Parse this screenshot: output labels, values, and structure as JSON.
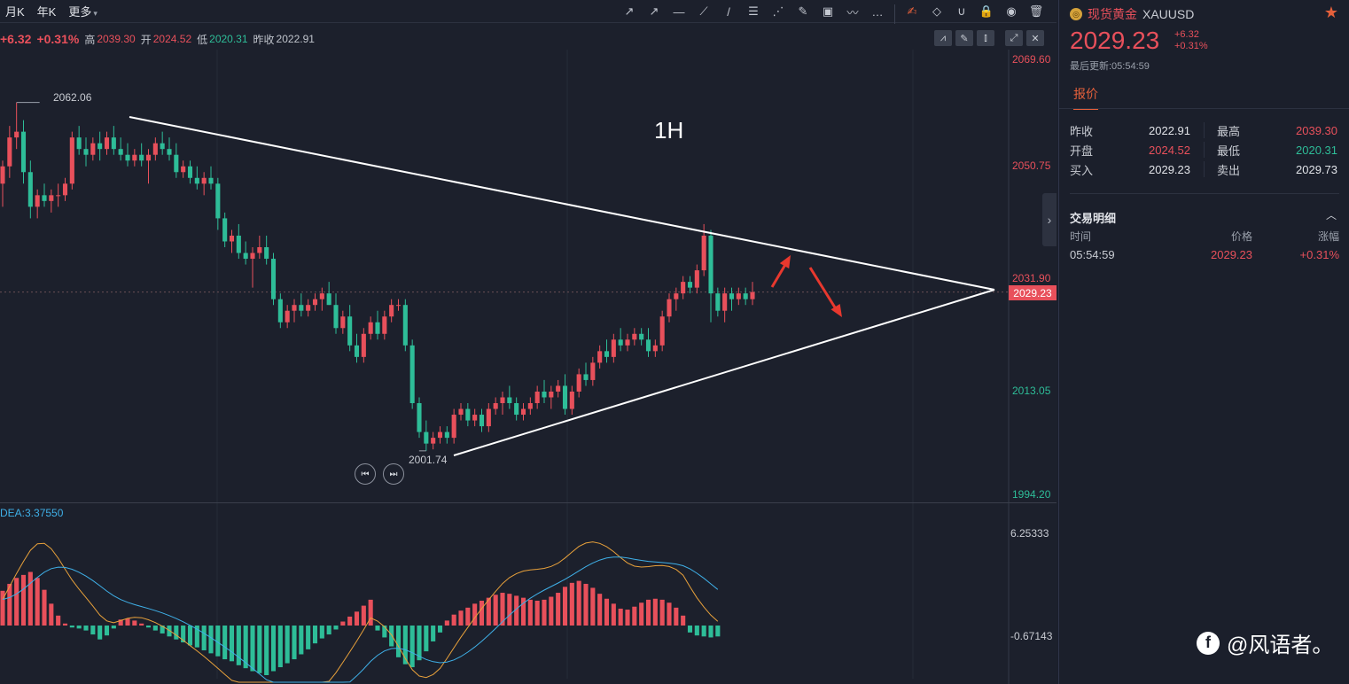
{
  "toolbar": {
    "periods": [
      "月K",
      "年K",
      "更多"
    ],
    "tools": [
      {
        "name": "arrow-line-icon",
        "glyph": "↗"
      },
      {
        "name": "ray-icon",
        "glyph": "↗"
      },
      {
        "name": "horizontal-line-icon",
        "glyph": "—"
      },
      {
        "name": "trend-line-icon",
        "glyph": "⟋"
      },
      {
        "name": "segment-icon",
        "glyph": "/"
      },
      {
        "name": "fibonacci-icon",
        "glyph": "☰"
      },
      {
        "name": "gann-fan-icon",
        "glyph": "⋰"
      },
      {
        "name": "brush-icon",
        "glyph": "✎"
      },
      {
        "name": "image-icon",
        "glyph": "▣"
      },
      {
        "name": "pattern-icon",
        "glyph": "〰"
      },
      {
        "name": "more-tools-icon",
        "glyph": "…"
      },
      {
        "name": "draw-mode-icon",
        "glyph": "✍"
      },
      {
        "name": "eraser-icon",
        "glyph": "◇"
      },
      {
        "name": "magnet-icon",
        "glyph": "∪"
      },
      {
        "name": "lock-icon",
        "glyph": "🔒"
      },
      {
        "name": "eye-icon",
        "glyph": "◉"
      },
      {
        "name": "trash-icon",
        "glyph": "🗑"
      }
    ]
  },
  "infobar": {
    "change": "+6.32",
    "change_pct": "+0.31%",
    "high_label": "高",
    "high": "2039.30",
    "open_label": "开",
    "open": "2024.52",
    "low_label": "低",
    "low": "2020.31",
    "prev_label": "昨收",
    "prev": "2022.91"
  },
  "chart_buttons": [
    {
      "name": "indicator-icon",
      "glyph": "⩘"
    },
    {
      "name": "pen-icon",
      "glyph": "✎"
    },
    {
      "name": "candle-type-icon",
      "glyph": "⫾"
    },
    {
      "name": "expand-icon",
      "glyph": "⤢"
    },
    {
      "name": "close-icon",
      "glyph": "✕"
    }
  ],
  "axis": {
    "price_labels": [
      {
        "value": "2069.60",
        "color": "#e8505b"
      },
      {
        "value": "2050.75",
        "color": "#e8505b"
      },
      {
        "value": "2031.90",
        "color": "#e8505b"
      },
      {
        "value": "2013.05",
        "color": "#2ebd98"
      },
      {
        "value": "1994.20",
        "color": "#2ebd98"
      }
    ],
    "current_price": "2029.23",
    "macd_labels": [
      "6.25333",
      "-0.67143"
    ]
  },
  "annotations": {
    "timeframe": "1H",
    "high_mark": "2062.06",
    "low_mark": "2001.74"
  },
  "macd": {
    "dea_label": "DEA:3.37550"
  },
  "chart_data": {
    "type": "candlestick",
    "symbol": "XAUUSD",
    "timeframe": "1H",
    "ylim": [
      1994.2,
      2069.6
    ],
    "candles": [
      [
        2048,
        2052,
        2044,
        2051
      ],
      [
        2051,
        2058,
        2049,
        2056
      ],
      [
        2056,
        2062.06,
        2054,
        2057
      ],
      [
        2057,
        2059,
        2048,
        2050
      ],
      [
        2050,
        2052,
        2042,
        2044
      ],
      [
        2044,
        2047,
        2042,
        2046
      ],
      [
        2046,
        2048,
        2044,
        2045
      ],
      [
        2045,
        2047,
        2043,
        2046
      ],
      [
        2046,
        2048,
        2044,
        2046
      ],
      [
        2046,
        2049,
        2045,
        2048
      ],
      [
        2048,
        2057,
        2047,
        2056
      ],
      [
        2056,
        2058,
        2053,
        2054
      ],
      [
        2054,
        2056,
        2051,
        2053
      ],
      [
        2053,
        2056,
        2052,
        2055
      ],
      [
        2055,
        2057,
        2052,
        2054
      ],
      [
        2054,
        2057,
        2053,
        2056
      ],
      [
        2056,
        2058,
        2053,
        2054
      ],
      [
        2054,
        2056,
        2052,
        2053
      ],
      [
        2053,
        2055,
        2051,
        2052
      ],
      [
        2052,
        2054,
        2051,
        2053
      ],
      [
        2053,
        2055,
        2051,
        2052
      ],
      [
        2052,
        2054,
        2048,
        2053
      ],
      [
        2053,
        2056,
        2052,
        2055
      ],
      [
        2055,
        2057,
        2053,
        2054
      ],
      [
        2054,
        2056,
        2052,
        2053
      ],
      [
        2053,
        2055,
        2049,
        2050
      ],
      [
        2050,
        2052,
        2049,
        2051
      ],
      [
        2051,
        2052,
        2048,
        2049
      ],
      [
        2049,
        2051,
        2047,
        2048
      ],
      [
        2048,
        2050,
        2046,
        2049
      ],
      [
        2049,
        2051,
        2047,
        2048
      ],
      [
        2048,
        2049,
        2040,
        2042
      ],
      [
        2042,
        2043,
        2037,
        2038
      ],
      [
        2038,
        2040,
        2036,
        2039
      ],
      [
        2039,
        2041,
        2035,
        2036
      ],
      [
        2036,
        2038,
        2034,
        2035
      ],
      [
        2035,
        2037,
        2030,
        2036
      ],
      [
        2036,
        2039,
        2035,
        2037
      ],
      [
        2037,
        2039,
        2034,
        2035
      ],
      [
        2035,
        2036,
        2027,
        2028
      ],
      [
        2028,
        2029,
        2023,
        2024
      ],
      [
        2024,
        2027,
        2023,
        2026
      ],
      [
        2026,
        2028,
        2024,
        2027
      ],
      [
        2027,
        2029,
        2025,
        2026
      ],
      [
        2026,
        2028,
        2025,
        2027
      ],
      [
        2027,
        2029,
        2026,
        2028
      ],
      [
        2028,
        2030,
        2026,
        2029
      ],
      [
        2029,
        2031,
        2027,
        2027
      ],
      [
        2027,
        2029,
        2022,
        2023
      ],
      [
        2023,
        2026,
        2022,
        2025
      ],
      [
        2025,
        2027,
        2019,
        2020
      ],
      [
        2020,
        2022,
        2017,
        2018
      ],
      [
        2018,
        2023,
        2017,
        2022
      ],
      [
        2022,
        2025,
        2021,
        2024
      ],
      [
        2024,
        2026,
        2021,
        2022
      ],
      [
        2022,
        2026,
        2021,
        2025
      ],
      [
        2025,
        2028,
        2024,
        2027
      ],
      [
        2027,
        2028,
        2026,
        2027
      ],
      [
        2027,
        2028,
        2019,
        2020
      ],
      [
        2020,
        2021,
        2009,
        2010
      ],
      [
        2010,
        2011,
        2004,
        2005
      ],
      [
        2005,
        2007,
        2001.74,
        2003
      ],
      [
        2003,
        2005,
        2002,
        2004
      ],
      [
        2004,
        2006,
        2003,
        2005
      ],
      [
        2005,
        2006,
        2003,
        2004
      ],
      [
        2004,
        2009,
        2003,
        2008
      ],
      [
        2008,
        2010,
        2007,
        2009
      ],
      [
        2009,
        2010,
        2006,
        2007
      ],
      [
        2007,
        2009,
        2006,
        2008
      ],
      [
        2008,
        2009,
        2005,
        2006
      ],
      [
        2006,
        2010,
        2005,
        2009
      ],
      [
        2009,
        2011,
        2008,
        2010
      ],
      [
        2010,
        2012,
        2008,
        2011
      ],
      [
        2011,
        2013,
        2009,
        2010
      ],
      [
        2010,
        2011,
        2007,
        2008
      ],
      [
        2008,
        2010,
        2007,
        2009
      ],
      [
        2009,
        2011,
        2008,
        2010
      ],
      [
        2010,
        2013,
        2009,
        2012
      ],
      [
        2012,
        2014,
        2010,
        2011
      ],
      [
        2011,
        2013,
        2009,
        2012
      ],
      [
        2012,
        2014,
        2011,
        2013
      ],
      [
        2013,
        2015,
        2008,
        2009
      ],
      [
        2009,
        2013,
        2008,
        2012
      ],
      [
        2012,
        2016,
        2011,
        2015
      ],
      [
        2015,
        2017,
        2013,
        2014
      ],
      [
        2014,
        2018,
        2013,
        2017
      ],
      [
        2017,
        2020,
        2016,
        2019
      ],
      [
        2019,
        2021,
        2017,
        2018
      ],
      [
        2018,
        2022,
        2017,
        2021
      ],
      [
        2021,
        2023,
        2019,
        2020
      ],
      [
        2020,
        2022,
        2019,
        2021
      ],
      [
        2021,
        2023,
        2020,
        2022
      ],
      [
        2022,
        2023,
        2020,
        2021
      ],
      [
        2021,
        2023,
        2018,
        2019
      ],
      [
        2019,
        2021,
        2018,
        2020
      ],
      [
        2020,
        2026,
        2019,
        2025
      ],
      [
        2025,
        2029,
        2024,
        2028
      ],
      [
        2028,
        2030,
        2026,
        2029
      ],
      [
        2029,
        2032,
        2028,
        2031
      ],
      [
        2031,
        2032,
        2029,
        2030
      ],
      [
        2030,
        2034,
        2029,
        2033
      ],
      [
        2033,
        2041,
        2032,
        2039
      ],
      [
        2039,
        2040,
        2024,
        2029
      ],
      [
        2029,
        2030,
        2025,
        2026
      ],
      [
        2026,
        2030,
        2024,
        2029
      ],
      [
        2029,
        2030,
        2026,
        2028
      ],
      [
        2028,
        2030,
        2027,
        2029
      ],
      [
        2029,
        2030,
        2027,
        2028
      ],
      [
        2028,
        2031,
        2027,
        2029.23
      ]
    ],
    "macd_hist": [
      3.5,
      4.2,
      4.8,
      5.1,
      5.4,
      4.8,
      3.6,
      2.2,
      1.0,
      0.2,
      -0.2,
      -0.3,
      -0.5,
      -0.9,
      -1.4,
      -1.0,
      -0.3,
      0.6,
      0.7,
      0.5,
      0.2,
      -0.2,
      -0.5,
      -0.8,
      -1.1,
      -1.4,
      -1.7,
      -2.0,
      -2.2,
      -2.5,
      -2.8,
      -3.1,
      -3.4,
      -3.6,
      -4.0,
      -4.3,
      -4.6,
      -4.8,
      -5.0,
      -4.6,
      -4.2,
      -3.8,
      -3.4,
      -2.9,
      -2.4,
      -1.8,
      -1.3,
      -0.9,
      -0.4,
      0.4,
      0.9,
      1.4,
      2.0,
      2.6,
      -0.5,
      -1.2,
      -2.1,
      -3.2,
      -3.9,
      -4.2,
      -3.5,
      -2.6,
      -1.6,
      -0.7,
      0.5,
      1.1,
      1.5,
      1.8,
      2.2,
      2.5,
      2.8,
      3.1,
      3.3,
      3.2,
      3.0,
      2.8,
      2.6,
      2.5,
      2.6,
      2.9,
      3.3,
      3.9,
      4.3,
      4.5,
      4.2,
      3.8,
      3.2,
      2.7,
      2.2,
      1.7,
      1.6,
      1.9,
      2.3,
      2.6,
      2.7,
      2.6,
      2.3,
      1.8,
      1.0,
      -0.7,
      -1.0,
      -1.1,
      -1.2,
      -1.1
    ]
  },
  "side_panel": {
    "symbol_name": "现货黄金",
    "symbol_code": "XAUUSD",
    "price": "2029.23",
    "change": "+6.32",
    "change_pct": "+0.31%",
    "updated": "最后更新:05:54:59",
    "tab": "报价",
    "quote_rows": [
      {
        "l1": "昨收",
        "v1": "2022.91",
        "c1": "#e1e3e8",
        "l2": "最高",
        "v2": "2039.30",
        "c2": "#e8505b"
      },
      {
        "l1": "开盘",
        "v1": "2024.52",
        "c1": "#e8505b",
        "l2": "最低",
        "v2": "2020.31",
        "c2": "#2ebd98"
      },
      {
        "l1": "买入",
        "v1": "2029.23",
        "c1": "#e1e3e8",
        "l2": "卖出",
        "v2": "2029.73",
        "c2": "#e1e3e8"
      }
    ],
    "trade_title": "交易明细",
    "trade_headers": [
      "时间",
      "价格",
      "涨幅"
    ],
    "trade_row": {
      "time": "05:54:59",
      "price": "2029.23",
      "pct": "+0.31%"
    }
  },
  "watermark": "@风语者。",
  "colors": {
    "up": "#e8505b",
    "down": "#2ebd98",
    "accent": "#e5603b",
    "bg": "#1c202c"
  }
}
